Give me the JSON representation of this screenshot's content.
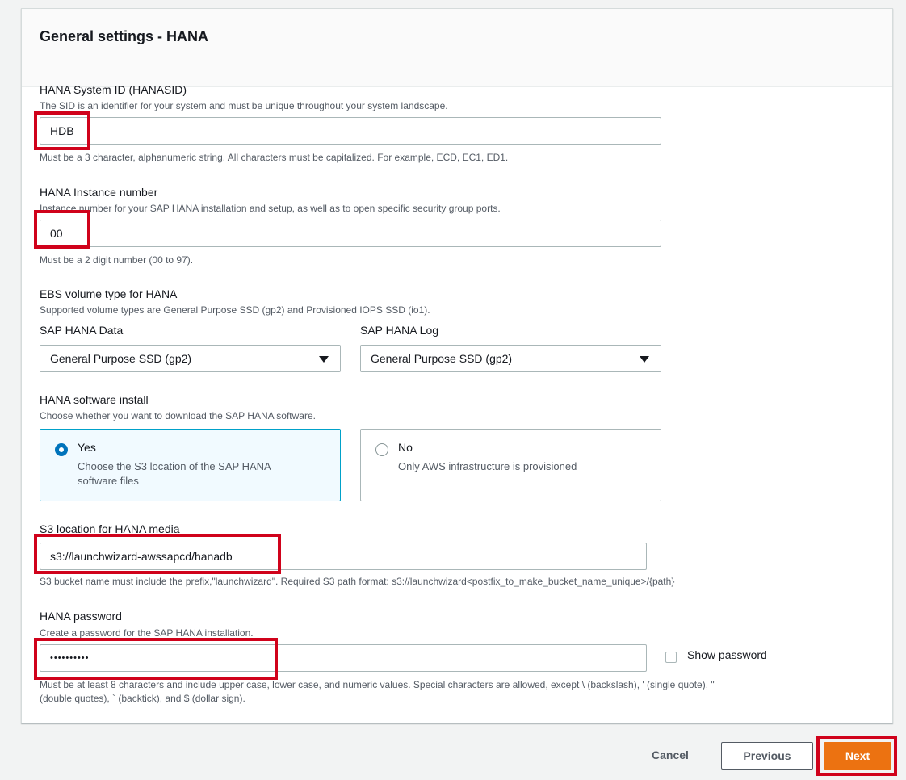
{
  "panel": {
    "title": "General settings - HANA"
  },
  "hanasid": {
    "label": "HANA System ID (HANASID)",
    "description": "The SID is an identifier for your system and must be unique throughout your system landscape.",
    "value": "HDB",
    "constraint": "Must be a 3 character, alphanumeric string. All characters must be capitalized. For example, ECD, EC1, ED1."
  },
  "instance_number": {
    "label": "HANA Instance number",
    "description": "Instance number for your SAP HANA installation and setup, as well as to open specific security group ports.",
    "value": "00",
    "constraint": "Must be a 2 digit number (00 to 97)."
  },
  "ebs": {
    "label": "EBS volume type for HANA",
    "description": "Supported volume types are General Purpose SSD (gp2) and Provisioned IOPS SSD (io1).",
    "data_label": "SAP HANA Data",
    "data_value": "General Purpose SSD (gp2)",
    "log_label": "SAP HANA Log",
    "log_value": "General Purpose SSD (gp2)"
  },
  "software_install": {
    "label": "HANA software install",
    "description": "Choose whether you want to download the SAP HANA software.",
    "yes_title": "Yes",
    "yes_desc_line1": "Choose the S3 location of the SAP HANA",
    "yes_desc_line2": "software files",
    "no_title": "No",
    "no_desc": "Only AWS infrastructure is provisioned",
    "selected": "Yes"
  },
  "s3_location": {
    "label": "S3 location for HANA media",
    "value": "s3://launchwizard-awssapcd/hanadb",
    "constraint": "S3 bucket name must include the prefix,\"launchwizard\". Required S3 path format: s3://launchwizard<postfix_to_make_bucket_name_unique>/{path}"
  },
  "password": {
    "label": "HANA password",
    "description": "Create a password for the SAP HANA installation.",
    "value": "••••••••••",
    "show_password_label": "Show password",
    "show_password_checked": false,
    "constraint_line1": "Must be at least 8 characters and include upper case, lower case, and numeric values. Special characters are allowed, except \\ (backslash), ' (single quote), \"",
    "constraint_line2": "(double quotes), ` (backtick), and $ (dollar sign)."
  },
  "footer": {
    "cancel_label": "Cancel",
    "previous_label": "Previous",
    "next_label": "Next"
  },
  "colors": {
    "primary_button": "#ec7211",
    "highlight_box": "#d0021b",
    "selected_radio": "#0073bb"
  }
}
